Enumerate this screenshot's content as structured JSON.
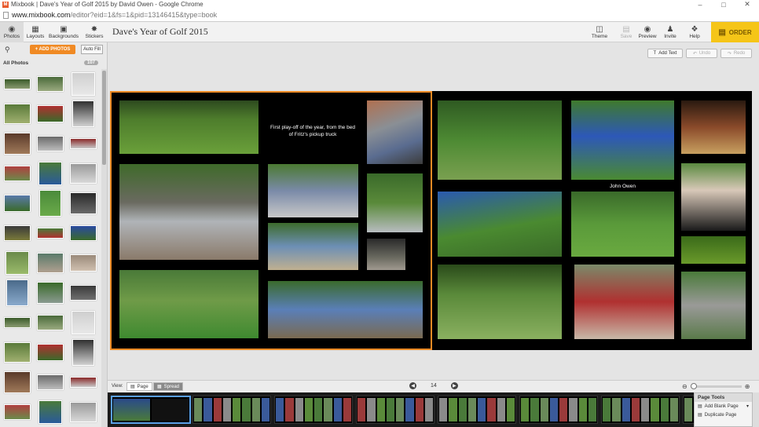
{
  "window": {
    "title": "Mixbook | Dave's Year of Golf 2015 by David Owen - Google Chrome",
    "url_host": "www.mixbook.com",
    "url_path": "/editor?eid=1&fs=1&pid=13146415&type=book"
  },
  "toolbar": {
    "tabs": [
      {
        "label": "Photos",
        "icon": "camera-icon"
      },
      {
        "label": "Layouts",
        "icon": "layouts-icon"
      },
      {
        "label": "Backgrounds",
        "icon": "backgrounds-icon"
      },
      {
        "label": "Stickers",
        "icon": "stickers-icon"
      }
    ],
    "doc_title": "Dave's Year of Golf 2015",
    "right": [
      {
        "label": "Theme",
        "icon": "theme-icon"
      },
      {
        "label": "Save",
        "icon": "save-icon"
      },
      {
        "label": "Preview",
        "icon": "eye-icon"
      },
      {
        "label": "Invite",
        "icon": "invite-icon"
      },
      {
        "label": "Help",
        "icon": "help-icon"
      }
    ],
    "order_label": "ORDER"
  },
  "left_panel": {
    "add_photos_label": "+ ADD PHOTOS",
    "auto_fill_label": "Auto Fill",
    "section_label": "All Photos",
    "count": "107"
  },
  "canvas": {
    "add_text_label": "Add Text",
    "undo_label": "Undo",
    "redo_label": "Redo",
    "captions": {
      "playoff": "First play-off of the year, from the bed of Fritz's pickup truck",
      "john": "John Owen"
    }
  },
  "bottom": {
    "view_label": "View:",
    "page_label": "Page",
    "spread_label": "Spread",
    "page_number": "14"
  },
  "page_tools": {
    "title": "Page Tools",
    "add_blank": "Add Blank Page",
    "duplicate": "Duplicate Page"
  }
}
